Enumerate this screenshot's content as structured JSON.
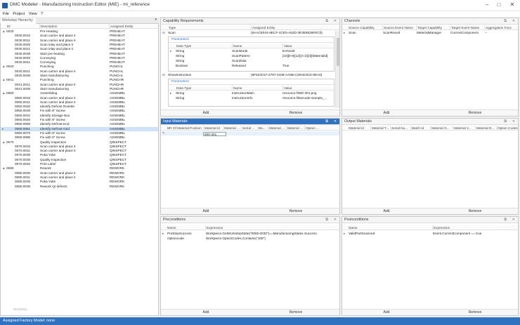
{
  "window": {
    "title": "DMC Modeler - Manufacturing Instruction Editor (MIE) - mi_reference"
  },
  "menu": [
    "File",
    "Project",
    "View",
    "?"
  ],
  "left": {
    "tab": "Workstep Hierarchy",
    "columns": [
      "ID",
      "Description",
      "Assigned Entity"
    ],
    "rows": [
      {
        "id": "0030",
        "desc": "Pre-Heating",
        "entity": "PREHEAT",
        "lvl": 0,
        "exp": "▲"
      },
      {
        "id": "0030.0010",
        "desc": "Scan carrier and place it",
        "entity": "PREHEAT",
        "lvl": 1
      },
      {
        "id": "0030.0011",
        "desc": "Scan carrier and place it",
        "entity": "PREHEAT",
        "lvl": 1
      },
      {
        "id": "0030.0020",
        "desc": "Scan inlay and place it",
        "entity": "PREHEAT",
        "lvl": 1
      },
      {
        "id": "0030.0021",
        "desc": "Scan inlay and place it",
        "entity": "PREHEAT",
        "lvl": 1
      },
      {
        "id": "0030.0030",
        "desc": "Start pre-heating",
        "entity": "PREHEAT",
        "lvl": 1
      },
      {
        "id": "0030.0040",
        "desc": "Conveying",
        "entity": "PREHEAT",
        "lvl": 1
      },
      {
        "id": "0030.0041",
        "desc": "Conveying",
        "entity": "PREHEAT",
        "lvl": 1
      },
      {
        "id": "0040",
        "desc": "Punching",
        "entity": "PUNCHL",
        "lvl": 0,
        "exp": "▲"
      },
      {
        "id": "0040.0011",
        "desc": "Scan carrier and place it",
        "entity": "PUNCHL",
        "lvl": 1
      },
      {
        "id": "0040.0030",
        "desc": "Start manufacturing",
        "entity": "PUNCHL",
        "lvl": 1
      },
      {
        "id": "0041",
        "desc": "Punching",
        "entity": "PUNCHR",
        "lvl": 0,
        "exp": "▲"
      },
      {
        "id": "0041.0011",
        "desc": "Scan carrier and place it",
        "entity": "PUNCHR",
        "lvl": 1
      },
      {
        "id": "0041.0030",
        "desc": "Start manufacturing",
        "entity": "PUNCHR",
        "lvl": 1
      },
      {
        "id": "0060",
        "desc": "Assembling",
        "entity": "ASSEMBL",
        "lvl": 0,
        "exp": "▲"
      },
      {
        "id": "0060.0010",
        "desc": "Scan carrier and place it",
        "entity": "ASSEMBL",
        "lvl": 1
      },
      {
        "id": "0060.0011",
        "desc": "Scan carrier and place it",
        "entity": "ASSEMBL",
        "lvl": 1
      },
      {
        "id": "0060.0020",
        "desc": "Identify Defrost Rosette",
        "entity": "ASSEMBL",
        "lvl": 1
      },
      {
        "id": "0060.0030",
        "desc": "Fix with 8\" Screw",
        "entity": "ASSEMBL",
        "lvl": 1
      },
      {
        "id": "0060.0031",
        "desc": "Identify Storage Box",
        "entity": "ASSEMBL",
        "lvl": 1
      },
      {
        "id": "0060.0040",
        "desc": "Fix with 8\" Screw",
        "entity": "ASSEMBL",
        "lvl": 1
      },
      {
        "id": "0060.0060",
        "desc": "Identify Defrost-Knd",
        "entity": "ASSEMBL",
        "lvl": 1
      },
      {
        "id": "0060.0061",
        "desc": "Identify Defrost-Grid",
        "entity": "ASSEMBL",
        "lvl": 1,
        "sel": true
      },
      {
        "id": "0060.0070",
        "desc": "Fix with 8\" Screw",
        "entity": "ASSEMBL",
        "lvl": 1
      },
      {
        "id": "0060.0080",
        "desc": "Fix with 6\" Screw",
        "entity": "ASSEMBL",
        "lvl": 1
      },
      {
        "id": "0070",
        "desc": "Quality Inspection",
        "entity": "QINSPECT",
        "lvl": 0,
        "exp": "▲"
      },
      {
        "id": "0070.0010",
        "desc": "Scan carrier and place it",
        "entity": "QINSPECT",
        "lvl": 1
      },
      {
        "id": "0070.0011",
        "desc": "Scan carrier and place it",
        "entity": "QINSPECT",
        "lvl": 1
      },
      {
        "id": "0070.0030",
        "desc": "Poka Yoke",
        "entity": "QINSPECT",
        "lvl": 1
      },
      {
        "id": "0070.0030",
        "desc": "Quality Inspection",
        "entity": "QINSPECT",
        "lvl": 1
      },
      {
        "id": "0070.0040",
        "desc": "Print Label",
        "entity": "QINSPECT",
        "lvl": 1
      },
      {
        "id": "0080",
        "desc": "Rework",
        "entity": "REWORK",
        "lvl": 0,
        "exp": "▲"
      },
      {
        "id": "0080.0030",
        "desc": "Scan carrier and place it",
        "entity": "REWORK",
        "lvl": 1
      },
      {
        "id": "0080.0011",
        "desc": "Scan carrier and place it",
        "entity": "REWORK",
        "lvl": 1
      },
      {
        "id": "0080.0030",
        "desc": "Poka Yoke",
        "entity": "REWORK",
        "lvl": 1
      },
      {
        "id": "0080.0030",
        "desc": "Rework QI defects",
        "entity": "REWORK",
        "lvl": 1
      }
    ],
    "footer": "Workstep"
  },
  "capability": {
    "title": "Capability Requirements",
    "columns": [
      "Type",
      "Assigned Entity"
    ],
    "items": [
      {
        "type": "Scan",
        "entity": "{6AACE944-8ECF-4CE0-A52D-3E3E8528FEC0}",
        "params": {
          "label": "Parameters",
          "cols": [
            "Data Type",
            "Name",
            "Value"
          ],
          "rows": [
            [
              "String",
              "ScanMode",
              "EAN128"
            ],
            [
              "String",
              "ScanPattern",
              "[10][0-9]{12}[A-Z]{3}[Materialid]"
            ],
            [
              "String",
              "ScanData",
              ""
            ],
            [
              "Boolean",
              "Released",
              "True"
            ]
          ]
        }
      },
      {
        "type": "ShowInstruction",
        "entity": "{5F523C57-2797-4338-AA6B-C29AE3CD-9EA0}",
        "params": {
          "label": "Parameters",
          "cols": [
            "Data Type",
            "Name",
            "Value"
          ],
          "rows": [
            [
              "String",
              "InstructionMain",
              "resource://800-301.png"
            ],
            [
              "String",
              "InstructionInfo",
              "resource://Barcode-Sample_..."
            ]
          ]
        }
      }
    ],
    "add": "Add",
    "remove": "Remove"
  },
  "channels": {
    "title": "Channels",
    "columns": [
      "Source Capability",
      "Source Event Name",
      "Target Capability",
      "Target Event Name",
      "Aggregation Func"
    ],
    "rows": [
      [
        "Scan",
        "ScanResult",
        "MaterialManager",
        "CurrentComponent",
        "--"
      ]
    ],
    "add": "Add",
    "remove": "Remove"
  },
  "input": {
    "title": "Input Materials",
    "columns": [
      "BR Of Material Position",
      "Material Id",
      "Material ...",
      "Serial ...",
      "Ba...",
      "Material ...",
      "Material ...",
      "Option ..."
    ],
    "value": "800-301",
    "add": "Add",
    "remove": "Remove"
  },
  "output": {
    "title": "Output Materials",
    "columns": [
      "Material Id",
      "Material T...",
      "Serial Nu...",
      "Batch Id",
      "Material G...",
      "Material V...",
      "Material D...",
      "Option Codes"
    ],
    "add": "Add",
    "remove": "Remove"
  },
  "pre": {
    "title": "Preconditions",
    "columns": [
      "Name",
      "Expression"
    ],
    "rows": [
      [
        "PreStepSuccess",
        "Workpiece.GetWorkstepState(\"0060.0030\")==ManufacturingStates.Success"
      ],
      [
        "Optioncode",
        "Workpiece.OptionCodes.Contains(\"108\")"
      ]
    ],
    "add": "Add",
    "remove": "Remove"
  },
  "post": {
    "title": "Postconditions",
    "columns": [
      "Name",
      "Expression"
    ],
    "rows": [
      [
        "ValidPartScanned",
        "Event.CurrentComponent == true"
      ]
    ],
    "add": "Add",
    "remove": "Remove"
  },
  "status": "Assigned Factory Model: none"
}
